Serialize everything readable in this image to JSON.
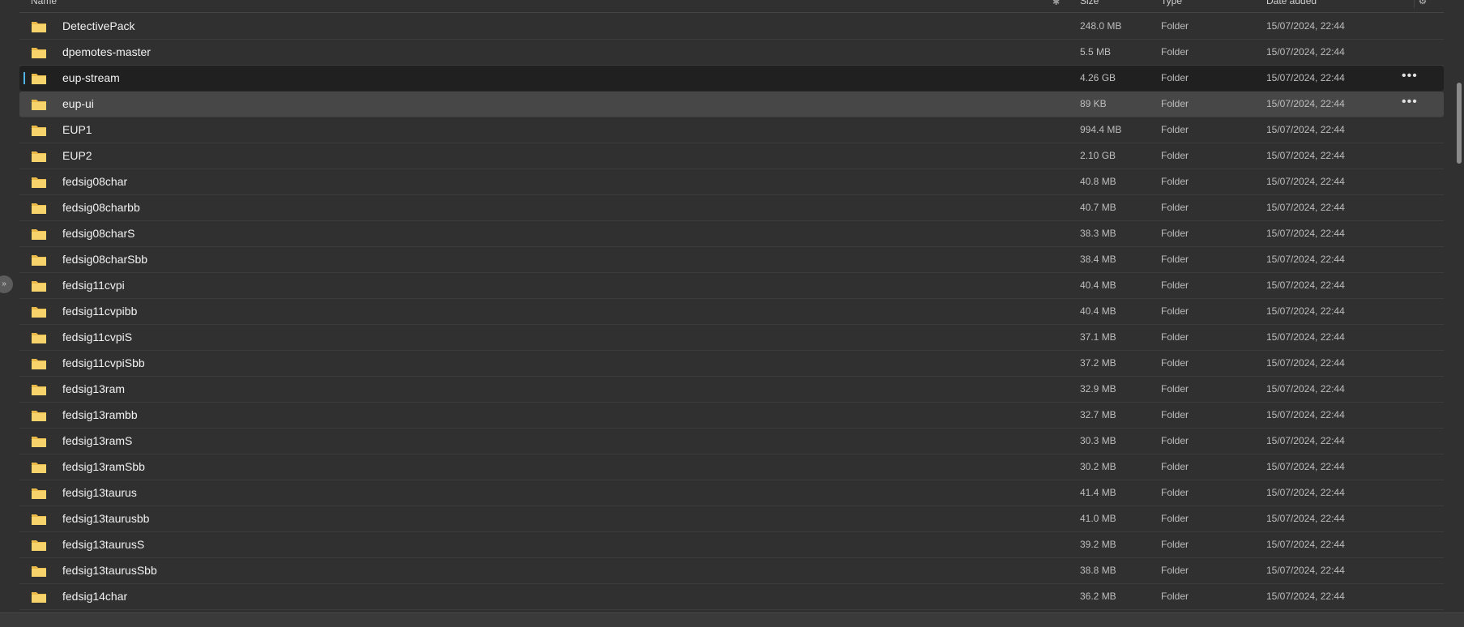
{
  "header": {
    "name": "Name",
    "sort_icon": "pin-icon",
    "size": "Size",
    "type": "Type",
    "date": "Date added",
    "settings_icon": "gear-icon"
  },
  "rows": [
    {
      "name": "DetectivePack",
      "size": "248.0 MB",
      "type": "Folder",
      "date": "15/07/2024, 22:44"
    },
    {
      "name": "dpemotes-master",
      "size": "5.5 MB",
      "type": "Folder",
      "date": "15/07/2024, 22:44"
    },
    {
      "name": "eup-stream",
      "size": "4.26 GB",
      "type": "Folder",
      "date": "15/07/2024, 22:44",
      "state": "selected"
    },
    {
      "name": "eup-ui",
      "size": "89 KB",
      "type": "Folder",
      "date": "15/07/2024, 22:44",
      "state": "hover"
    },
    {
      "name": "EUP1",
      "size": "994.4 MB",
      "type": "Folder",
      "date": "15/07/2024, 22:44"
    },
    {
      "name": "EUP2",
      "size": "2.10 GB",
      "type": "Folder",
      "date": "15/07/2024, 22:44"
    },
    {
      "name": "fedsig08char",
      "size": "40.8 MB",
      "type": "Folder",
      "date": "15/07/2024, 22:44"
    },
    {
      "name": "fedsig08charbb",
      "size": "40.7 MB",
      "type": "Folder",
      "date": "15/07/2024, 22:44"
    },
    {
      "name": "fedsig08charS",
      "size": "38.3 MB",
      "type": "Folder",
      "date": "15/07/2024, 22:44"
    },
    {
      "name": "fedsig08charSbb",
      "size": "38.4 MB",
      "type": "Folder",
      "date": "15/07/2024, 22:44"
    },
    {
      "name": "fedsig11cvpi",
      "size": "40.4 MB",
      "type": "Folder",
      "date": "15/07/2024, 22:44"
    },
    {
      "name": "fedsig11cvpibb",
      "size": "40.4 MB",
      "type": "Folder",
      "date": "15/07/2024, 22:44"
    },
    {
      "name": "fedsig11cvpiS",
      "size": "37.1 MB",
      "type": "Folder",
      "date": "15/07/2024, 22:44"
    },
    {
      "name": "fedsig11cvpiSbb",
      "size": "37.2 MB",
      "type": "Folder",
      "date": "15/07/2024, 22:44"
    },
    {
      "name": "fedsig13ram",
      "size": "32.9 MB",
      "type": "Folder",
      "date": "15/07/2024, 22:44"
    },
    {
      "name": "fedsig13rambb",
      "size": "32.7 MB",
      "type": "Folder",
      "date": "15/07/2024, 22:44"
    },
    {
      "name": "fedsig13ramS",
      "size": "30.3 MB",
      "type": "Folder",
      "date": "15/07/2024, 22:44"
    },
    {
      "name": "fedsig13ramSbb",
      "size": "30.2 MB",
      "type": "Folder",
      "date": "15/07/2024, 22:44"
    },
    {
      "name": "fedsig13taurus",
      "size": "41.4 MB",
      "type": "Folder",
      "date": "15/07/2024, 22:44"
    },
    {
      "name": "fedsig13taurusbb",
      "size": "41.0 MB",
      "type": "Folder",
      "date": "15/07/2024, 22:44"
    },
    {
      "name": "fedsig13taurusS",
      "size": "39.2 MB",
      "type": "Folder",
      "date": "15/07/2024, 22:44"
    },
    {
      "name": "fedsig13taurusSbb",
      "size": "38.8 MB",
      "type": "Folder",
      "date": "15/07/2024, 22:44"
    },
    {
      "name": "fedsig14char",
      "size": "36.2 MB",
      "type": "Folder",
      "date": "15/07/2024, 22:44"
    }
  ],
  "more_icon": "ellipsis-icon",
  "folder_icon": "folder-icon",
  "collapse_icon": "double-chevron-right-icon",
  "colors": {
    "background": "#303030",
    "selected": "#202020",
    "hover": "#474747",
    "accent": "#4fb3e8",
    "folder": "#f2c94c"
  }
}
